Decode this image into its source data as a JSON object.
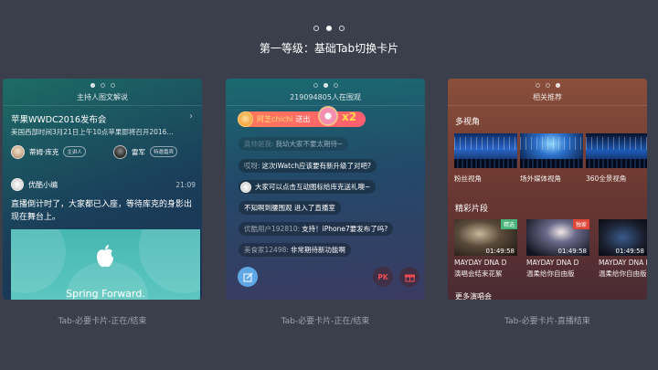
{
  "pager": {
    "count": 3,
    "active": 1
  },
  "headline": "第一等级：基础Tab切换卡片",
  "cards": [
    {
      "title": "主持人图文解说",
      "event_title": "苹果WWDC2016发布会",
      "event_sub": "美国西部时间3月21日上午10点苹果即将召开2016...",
      "people": [
        {
          "name": "蒂姆·库克",
          "tag": "主讲人"
        },
        {
          "name": "雷军",
          "tag": "特邀嘉宾"
        }
      ],
      "post_author": "优酷小编",
      "post_time": "21:09",
      "post_text": "直播倒计时了，大家都已入座，等待库克的身影出现在舞台上。",
      "banner_text": "Spring Forward.",
      "caption": "Tab-必要卡片-正在/结束"
    },
    {
      "title": "219094805人在围观",
      "gift": {
        "name": "阿芝chichi",
        "action": "送出",
        "count": "x2"
      },
      "messages": [
        {
          "who": "真帅是我:",
          "text": "我幼大家不要太期待~",
          "faded": true
        },
        {
          "who": "哎呀:",
          "text": "这次iWatch应该要有新升级了对吧?"
        },
        {
          "who": "",
          "text": "大家可以点击互动图标给库克送礼噢~",
          "avatar": true
        },
        {
          "who": "",
          "text": "不知啊到腰围观 进入了直播室"
        },
        {
          "who": "优酷用户192810:",
          "text": "支持！iPhone7要发布了吗?"
        },
        {
          "who": "美食家12498:",
          "text": "非常期待新功能啊"
        }
      ],
      "pk_label": "PK",
      "caption": "Tab-必要卡片-正在/结束"
    },
    {
      "title": "相关推荐",
      "section1": "多视角",
      "views": [
        "粉丝视角",
        "场外媒体视角",
        "360全景视角"
      ],
      "section2": "精彩片段",
      "clips": [
        {
          "duration": "01:49:58",
          "title": "MAYDAY DNA D",
          "sub": "演唱会结束花絮",
          "badge": "精选"
        },
        {
          "duration": "01:49:58",
          "title": "MAYDAY DNA D",
          "sub": "温柔给你自由版",
          "badge": "独家"
        },
        {
          "duration": "01:49:58",
          "title": "MAYDAY DNA D",
          "sub": "温柔给你自由版",
          "badge": ""
        }
      ],
      "section3": "更多演唱会",
      "caption": "Tab-必要卡片-直播结束"
    }
  ]
}
